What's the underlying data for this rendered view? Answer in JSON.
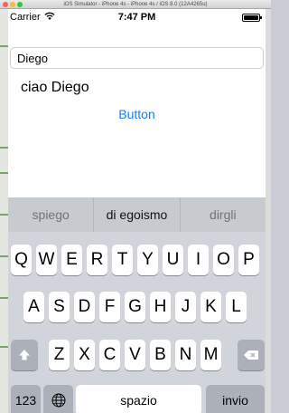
{
  "window": {
    "title": "iOS Simulator - iPhone 4s - iPhone 4s / iOS 8.0 (12A4265u)"
  },
  "status_bar": {
    "carrier": "Carrier",
    "time": "7:47 PM",
    "battery_level": 1.0
  },
  "form": {
    "name_value": "Diego",
    "greeting": "ciao Diego",
    "button_label": "Button",
    "accent_color": "#1a7ef2"
  },
  "keyboard": {
    "suggestions": [
      "spiego",
      "di egoismo",
      "dirgli"
    ],
    "row1": [
      "Q",
      "W",
      "E",
      "R",
      "T",
      "Y",
      "U",
      "I",
      "O",
      "P"
    ],
    "row2": [
      "A",
      "S",
      "D",
      "F",
      "G",
      "H",
      "J",
      "K",
      "L"
    ],
    "row3": [
      "Z",
      "X",
      "C",
      "V",
      "B",
      "N",
      "M"
    ],
    "numbers_key": "123",
    "space_key": "spazio",
    "return_key": "invio",
    "shift_icon": "shift-arrow-icon",
    "delete_icon": "backspace-icon",
    "globe_icon": "globe-icon"
  }
}
